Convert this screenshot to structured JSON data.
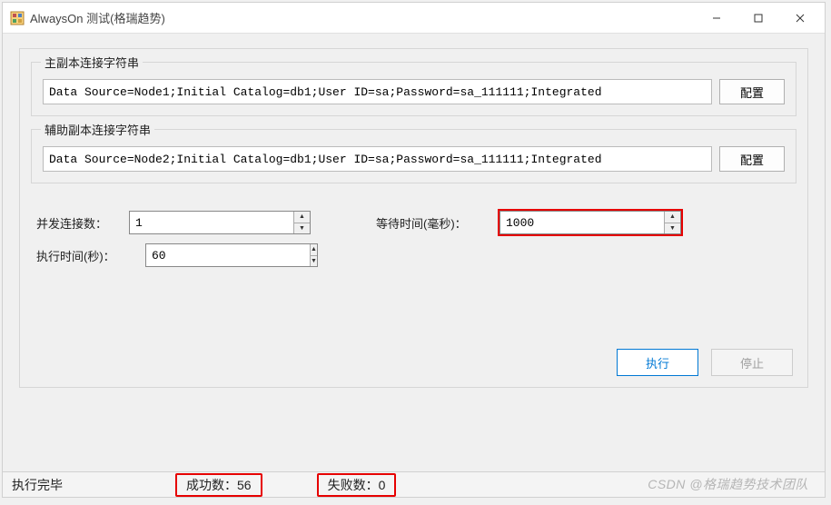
{
  "window": {
    "title": "AlwaysOn 测试(格瑞趋势)"
  },
  "primary": {
    "group_title": "主副本连接字符串",
    "conn_value": "Data Source=Node1;Initial Catalog=db1;User ID=sa;Password=sa_111111;Integrated",
    "config_label": "配置"
  },
  "secondary": {
    "group_title": "辅助副本连接字符串",
    "conn_value": "Data Source=Node2;Initial Catalog=db1;User ID=sa;Password=sa_111111;Integrated",
    "config_label": "配置"
  },
  "params": {
    "concurrent_label": "并发连接数：",
    "concurrent_value": "1",
    "wait_label": "等待时间(毫秒)：",
    "wait_value": "1000",
    "exec_time_label": "执行时间(秒)：",
    "exec_time_value": "60"
  },
  "actions": {
    "execute_label": "执行",
    "stop_label": "停止"
  },
  "status": {
    "state": "执行完毕",
    "success_label": "成功数：",
    "success_value": "56",
    "fail_label": "失败数：",
    "fail_value": "0"
  },
  "watermark": "CSDN @格瑞趋势技术团队"
}
